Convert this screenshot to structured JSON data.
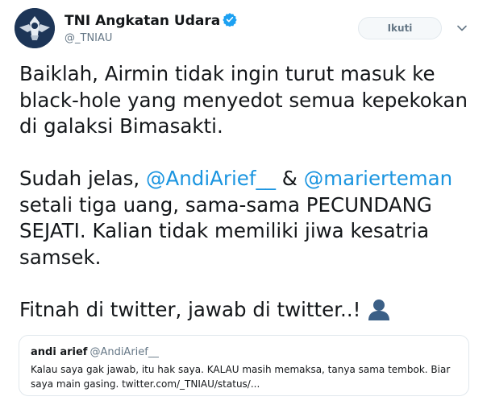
{
  "author": {
    "display_name": "TNI Angkatan Udara",
    "handle": "@_TNIAU",
    "verified": true,
    "avatar_icon": "air-force-emblem-icon"
  },
  "actions": {
    "follow_label": "Ikuti",
    "menu_icon": "chevron-down-icon"
  },
  "tweet": {
    "line1": "Baiklah, Airmin tidak ingin turut masuk ke",
    "line2": "black-hole yang menyedot semua kepekokan",
    "line3": "di galaksi Bimasakti.",
    "p2_before": "Sudah jelas, ",
    "mention1": "@AndiArief__",
    "p2_amp": " & ",
    "mention2": "@marierteman",
    "p2_line2": "setali tiga uang, sama-sama PECUNDANG",
    "p2_line3": "SEJATI. Kalian tidak memiliki jiwa kesatria",
    "p2_line4": "samsek.",
    "p3": "Fitnah di twitter, jawab di twitter..!",
    "emoji_icon": "bust-in-silhouette-icon"
  },
  "quoted_tweet": {
    "display_name": "andi arief",
    "handle": "@AndiArief__",
    "text_line1": "Kalau saya gak jawab, itu hak saya.  KALAU masih memaksa, tanya sama tembok. Biar",
    "text_line2": "saya main gasing. twitter.com/_TNIAU/status/..."
  },
  "colors": {
    "text": "#14171a",
    "secondary": "#657786",
    "link": "#1b95e0",
    "verified": "#1da1f2",
    "border": "#e1e8ed"
  }
}
